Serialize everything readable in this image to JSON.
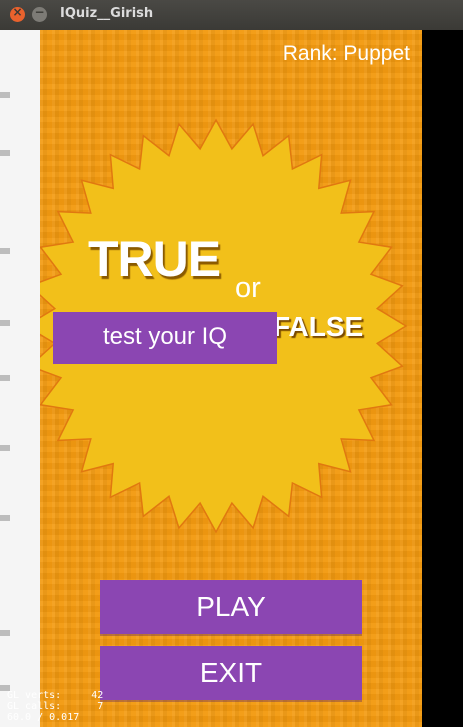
{
  "window": {
    "title": "IQuiz__Girish",
    "close_symbol": "×",
    "minimize_symbol": "−"
  },
  "game": {
    "rank_text": "Rank: Puppet",
    "title_true": "TRUE",
    "title_or": "or",
    "title_false": "FALSE",
    "tagline": "test your IQ",
    "play_label": "PLAY",
    "exit_label": "EXIT"
  },
  "debug": {
    "gl_verts": "GL verts:     42",
    "gl_calls": "GL calls:      7",
    "fps": "60.0 / 0.017"
  },
  "colors": {
    "background": "#f39a10",
    "starburst": "#f2c01a",
    "starburst_outline": "#e07810",
    "button": "#8b46b2",
    "text": "#ffffff"
  }
}
